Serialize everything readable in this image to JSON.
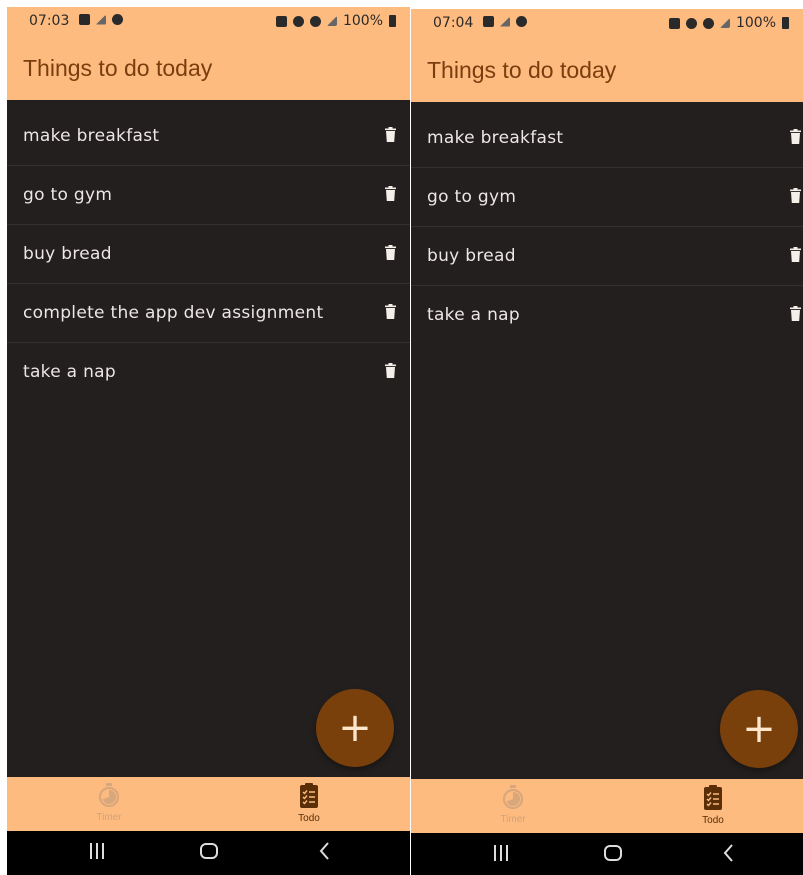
{
  "screens": [
    {
      "status": {
        "time": "07:03",
        "battery": "100%"
      },
      "app_title": "Things to do today",
      "tasks": [
        {
          "label": "make breakfast"
        },
        {
          "label": "go to gym"
        },
        {
          "label": "buy bread"
        },
        {
          "label": "complete the app dev assignment"
        },
        {
          "label": "take a nap"
        }
      ],
      "fab": {
        "icon": "plus-icon",
        "symbol": "+"
      },
      "bottom_nav": {
        "timer_label": "Timer",
        "todo_label": "Todo",
        "active": "todo"
      }
    },
    {
      "status": {
        "time": "07:04",
        "battery": "100%"
      },
      "app_title": "Things to do today",
      "tasks": [
        {
          "label": "make breakfast"
        },
        {
          "label": "go to gym"
        },
        {
          "label": "buy bread"
        },
        {
          "label": "take a nap"
        }
      ],
      "fab": {
        "icon": "plus-icon",
        "symbol": "+"
      },
      "bottom_nav": {
        "timer_label": "Timer",
        "todo_label": "Todo",
        "active": "todo"
      }
    }
  ],
  "colors": {
    "app_bar": "#fdbb80",
    "background": "#231f1f",
    "title": "#7a3e0e",
    "fab": "#7a400b",
    "task_text": "#ece6e6"
  },
  "icons": {
    "delete": "trash-icon",
    "timer": "stopwatch-icon",
    "todo": "clipboard-checklist-icon",
    "recents": "recents-icon",
    "home": "home-icon",
    "back": "back-icon"
  }
}
